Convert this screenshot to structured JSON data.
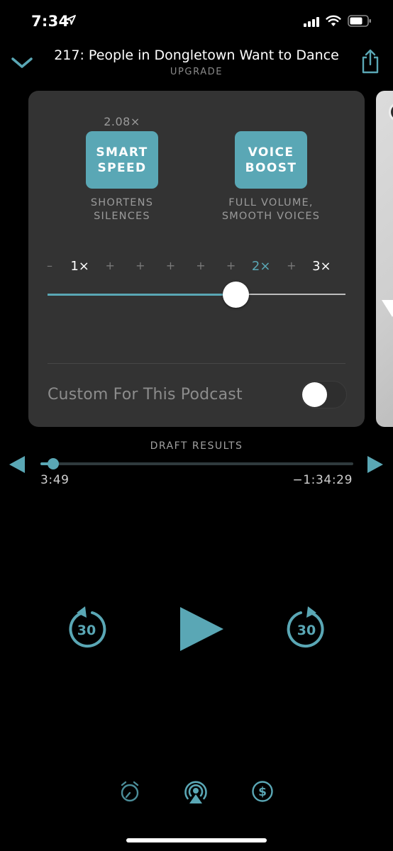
{
  "status_bar": {
    "time": "7:34"
  },
  "header": {
    "episode_title": "217: People in Dongletown Want to Dance",
    "upgrade_label": "UPGRADE"
  },
  "effects": {
    "speed_value": "2.08×",
    "smart_speed": {
      "line1": "SMART",
      "line2": "SPEED",
      "desc1": "SHORTENS",
      "desc2": "SILENCES"
    },
    "voice_boost": {
      "line1": "VOICE",
      "line2": "BOOST",
      "desc1": "FULL VOLUME,",
      "desc2": "SMOOTH VOICES"
    },
    "speed_scale": {
      "ticks": [
        "–",
        "1×",
        "+",
        "+",
        "+",
        "+",
        "+",
        "2×",
        "+",
        "3×"
      ],
      "active_tick": "2×",
      "value": 2.08,
      "min": 0.5,
      "max": 3.0
    },
    "custom_label": "Custom For This Podcast",
    "custom_enabled": false
  },
  "playback": {
    "chapter_title": "DRAFT RESULTS",
    "elapsed": "3:49",
    "remaining": "−1:34:29",
    "progress_fraction": 0.04,
    "skip_back_seconds": "30",
    "skip_forward_seconds": "30"
  },
  "colors": {
    "accent": "#5aa7b5",
    "card": "#333333",
    "background": "#000000"
  },
  "bottom_icons": [
    "sleep-timer-icon",
    "airplay-icon",
    "tip-jar-icon"
  ]
}
